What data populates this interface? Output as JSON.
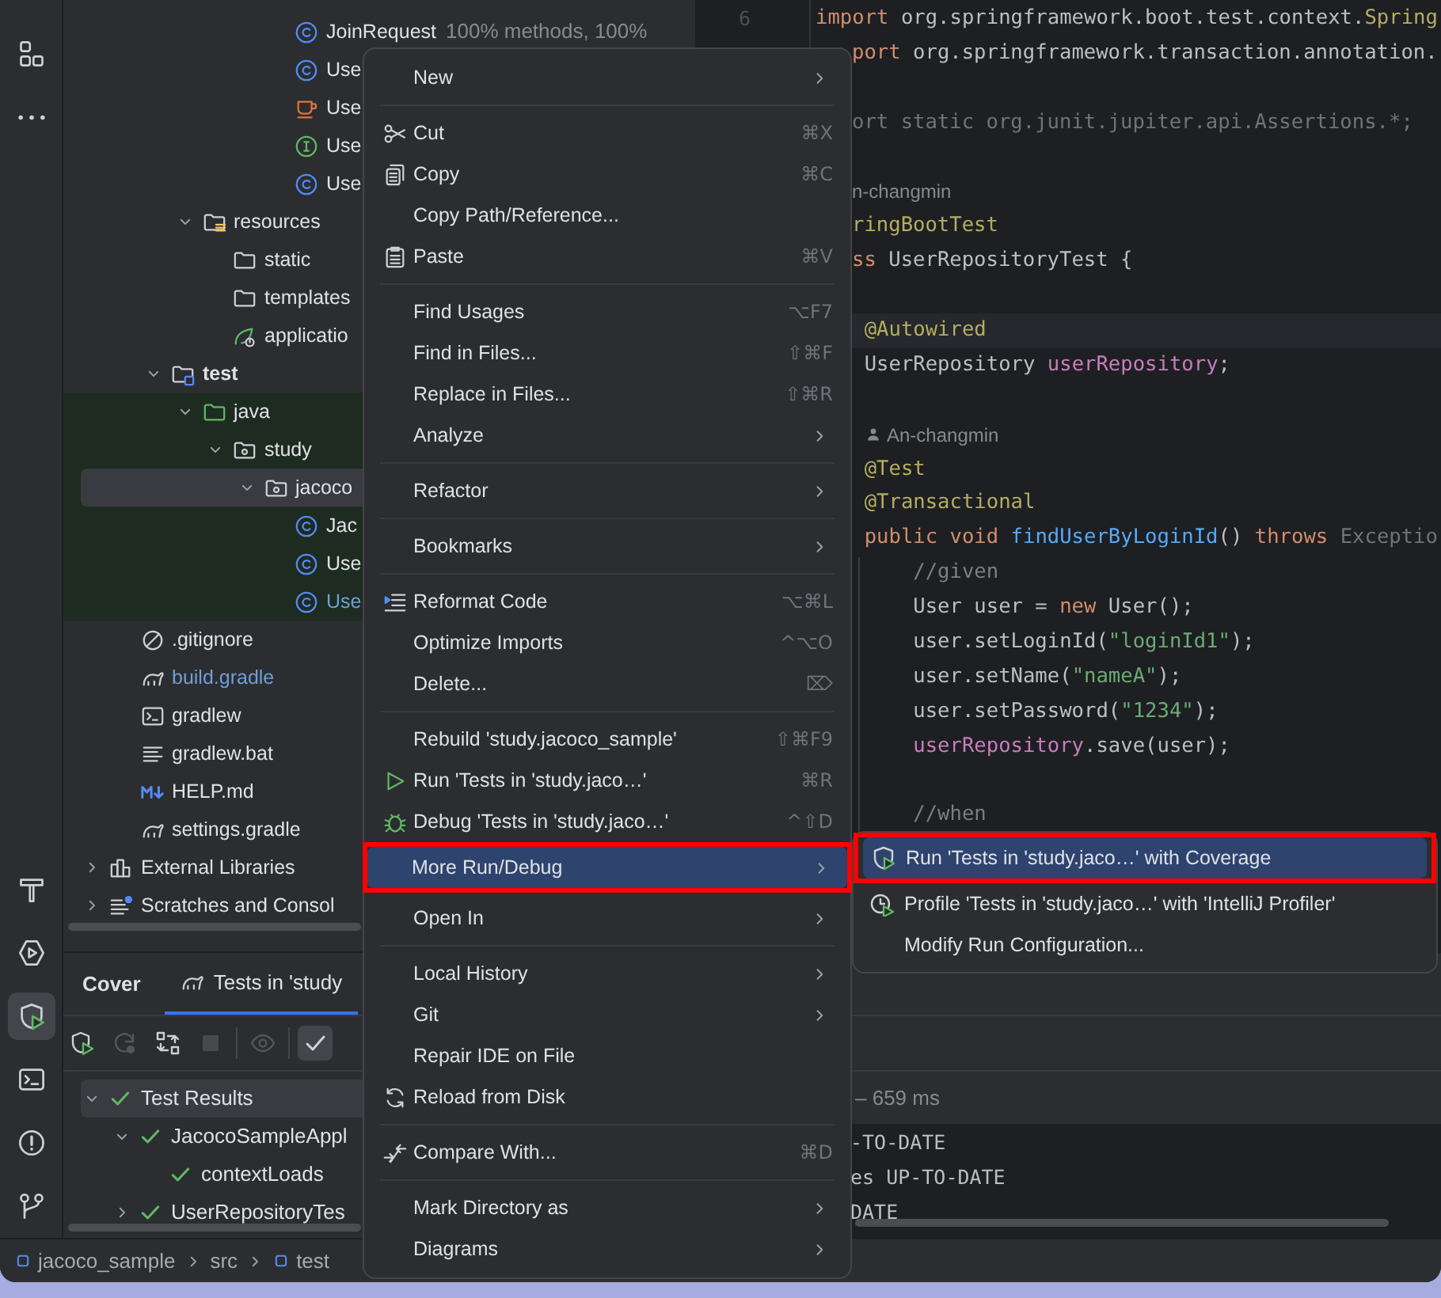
{
  "activity_bar": {
    "top": [
      {
        "kind": "structure",
        "selected": false
      },
      {
        "kind": "more",
        "selected": false
      }
    ],
    "bottom": [
      {
        "kind": "build",
        "selected": false
      },
      {
        "kind": "services",
        "selected": false
      },
      {
        "kind": "coverage",
        "selected": true
      },
      {
        "kind": "terminal",
        "selected": false
      },
      {
        "kind": "problems",
        "selected": false
      },
      {
        "kind": "git",
        "selected": false
      }
    ]
  },
  "project_tree": {
    "items": [
      {
        "children": [
          {
            "children": [
              {
                "children": [
                  {
                    "children": [
                      {
                        "children": [
                          {
                            "children": [
                              {
                                "label": "JoinRequest",
                                "kind": "class",
                                "hint": "100% methods, 100%",
                                "selected": false,
                                "modified": false
                              },
                              {
                                "label": "Use",
                                "kind": "class",
                                "selected": false,
                                "modified": false
                              },
                              {
                                "label": "Use",
                                "kind": "cup",
                                "selected": false,
                                "modified": false
                              },
                              {
                                "label": "Use",
                                "kind": "interface",
                                "selected": false,
                                "modified": false
                              },
                              {
                                "label": "Use",
                                "kind": "class",
                                "selected": false,
                                "modified": false
                              }
                            ]
                          }
                        ]
                      }
                    ]
                  },
                  {
                    "label": "resources",
                    "kind": "resources-folder",
                    "expanded": true,
                    "selected": false,
                    "modified": false,
                    "children": [
                      {
                        "label": "static",
                        "kind": "folder",
                        "selected": false,
                        "modified": false
                      },
                      {
                        "label": "templates",
                        "kind": "folder",
                        "selected": false,
                        "modified": false
                      },
                      {
                        "label": "applicatio",
                        "kind": "spring-config",
                        "selected": false,
                        "modified": false
                      }
                    ]
                  }
                ]
              },
              {
                "label": "test",
                "kind": "test-folder",
                "expanded": true,
                "bold": true,
                "selected": false,
                "modified": false,
                "children": [
                  {
                    "label": "java",
                    "kind": "source-folder",
                    "expanded": true,
                    "test_root": true,
                    "selected": false,
                    "modified": false,
                    "children": [
                      {
                        "label": "study",
                        "kind": "package",
                        "expanded": true,
                        "selected": false,
                        "modified": false,
                        "children": [
                          {
                            "label": "jacoco",
                            "kind": "package",
                            "expanded": true,
                            "selected": true,
                            "modified": false,
                            "children": [
                              {
                                "label": "Jac",
                                "kind": "class",
                                "selected": false,
                                "modified": false
                              },
                              {
                                "label": "Use",
                                "kind": "class",
                                "selected": false,
                                "modified": false
                              },
                              {
                                "label": "Use",
                                "kind": "class",
                                "selected": false,
                                "modified": true
                              }
                            ]
                          }
                        ]
                      }
                    ]
                  }
                ]
              }
            ]
          },
          {
            "label": ".gitignore",
            "kind": "ignore",
            "selected": false,
            "modified": false
          },
          {
            "label": "build.gradle",
            "kind": "gradle",
            "selected": false,
            "modified": true
          },
          {
            "label": "gradlew",
            "kind": "shell",
            "selected": false,
            "modified": false
          },
          {
            "label": "gradlew.bat",
            "kind": "text",
            "selected": false,
            "modified": false
          },
          {
            "label": "HELP.md",
            "kind": "markdown",
            "selected": false,
            "modified": false
          },
          {
            "label": "settings.gradle",
            "kind": "gradle",
            "selected": false,
            "modified": false
          }
        ]
      },
      {
        "label": "External Libraries",
        "kind": "libraries",
        "expanded": false,
        "selected": false,
        "modified": false
      },
      {
        "label": "Scratches and Consol",
        "kind": "scratches",
        "expanded": false,
        "selected": false,
        "modified": false
      }
    ]
  },
  "editor": {
    "line_number": "6",
    "lines": [
      {
        "kind": "code",
        "current": false,
        "segments": [
          {
            "text": "import ",
            "kind": "kw"
          },
          {
            "text": "org.springframework.boot.test.context.",
            "kind": "plain"
          },
          {
            "text": "Spring",
            "kind": "ann"
          }
        ]
      },
      {
        "kind": "code",
        "cut": true,
        "current": false,
        "segments": [
          {
            "text": "port ",
            "kind": "kw"
          },
          {
            "text": "org.springframework.transaction.annotation.",
            "kind": "plain"
          }
        ]
      },
      {
        "kind": "blank"
      },
      {
        "kind": "code",
        "cut": true,
        "current": false,
        "segments": [
          {
            "text": "ort static org.junit.jupiter.api.Assertions.*;",
            "kind": "muted"
          }
        ]
      },
      {
        "kind": "blank"
      },
      {
        "kind": "author",
        "cut": true,
        "member": false,
        "text": "n-changmin"
      },
      {
        "kind": "code",
        "cut": true,
        "current": false,
        "segments": [
          {
            "text": "ringBootTest",
            "kind": "ann"
          }
        ]
      },
      {
        "kind": "code",
        "cut": true,
        "current": false,
        "segments": [
          {
            "text": "ss ",
            "kind": "kw"
          },
          {
            "text": "UserRepositoryTest {",
            "kind": "plain"
          }
        ]
      },
      {
        "kind": "blank"
      },
      {
        "kind": "code",
        "current": true,
        "segments": [
          {
            "text": "    @Autowired",
            "kind": "ann"
          }
        ]
      },
      {
        "kind": "code",
        "current": false,
        "segments": [
          {
            "text": "    UserRepository ",
            "kind": "plain"
          },
          {
            "text": "userRepository",
            "kind": "field"
          },
          {
            "text": ";",
            "kind": "plain"
          }
        ]
      },
      {
        "kind": "blank"
      },
      {
        "kind": "author",
        "member": true,
        "text": "An-changmin"
      },
      {
        "kind": "code",
        "current": false,
        "segments": [
          {
            "text": "    @Test",
            "kind": "ann"
          }
        ]
      },
      {
        "kind": "code",
        "current": false,
        "segments": [
          {
            "text": "    @Transactional",
            "kind": "ann"
          }
        ]
      },
      {
        "kind": "code",
        "current": false,
        "segments": [
          {
            "text": "    public void ",
            "kind": "kw"
          },
          {
            "text": "findUserByLoginId",
            "kind": "method"
          },
          {
            "text": "() ",
            "kind": "plain"
          },
          {
            "text": "throws ",
            "kind": "kw"
          },
          {
            "text": "Exceptio",
            "kind": "muted"
          }
        ]
      },
      {
        "kind": "code",
        "current": false,
        "segments": [
          {
            "text": "        //given",
            "kind": "comment"
          }
        ]
      },
      {
        "kind": "code",
        "current": false,
        "segments": [
          {
            "text": "        User user = ",
            "kind": "plain"
          },
          {
            "text": "new ",
            "kind": "kw"
          },
          {
            "text": "User();",
            "kind": "plain"
          }
        ]
      },
      {
        "kind": "code",
        "current": false,
        "segments": [
          {
            "text": "        user.setLoginId(",
            "kind": "plain"
          },
          {
            "text": "\"loginId1\"",
            "kind": "str"
          },
          {
            "text": ");",
            "kind": "plain"
          }
        ]
      },
      {
        "kind": "code",
        "current": false,
        "segments": [
          {
            "text": "        user.setName(",
            "kind": "plain"
          },
          {
            "text": "\"nameA\"",
            "kind": "str"
          },
          {
            "text": ");",
            "kind": "plain"
          }
        ]
      },
      {
        "kind": "code",
        "current": false,
        "segments": [
          {
            "text": "        user.setPassword(",
            "kind": "plain"
          },
          {
            "text": "\"1234\"",
            "kind": "str"
          },
          {
            "text": ");",
            "kind": "plain"
          }
        ]
      },
      {
        "kind": "code",
        "current": false,
        "segments": [
          {
            "text": "        userRepository",
            "kind": "field"
          },
          {
            "text": ".save(user);",
            "kind": "plain"
          }
        ]
      },
      {
        "kind": "blank"
      },
      {
        "kind": "code",
        "current": false,
        "segments": [
          {
            "text": "        //when",
            "kind": "comment"
          }
        ]
      }
    ]
  },
  "tool_window": {
    "title": "Cover",
    "tabs": [
      {
        "label": "Tests in 'study",
        "selected": true
      }
    ],
    "toolbar": [
      {
        "kind": "coverage-run",
        "disabled": false,
        "on": false
      },
      {
        "kind": "rerun",
        "disabled": true,
        "on": false
      },
      {
        "kind": "sync",
        "disabled": false,
        "on": false
      },
      {
        "kind": "stop",
        "disabled": true,
        "on": false
      },
      {
        "kind": "separator"
      },
      {
        "kind": "eye",
        "disabled": true,
        "on": false
      },
      {
        "kind": "separator"
      },
      {
        "kind": "check",
        "disabled": false,
        "on": true
      }
    ],
    "tests": [
      {
        "label": "Test Results",
        "expanded": true,
        "selected": true,
        "passed": true,
        "children": [
          {
            "label": "JacocoSampleAppl",
            "expanded": true,
            "selected": false,
            "passed": true,
            "children": [
              {
                "label": "contextLoads",
                "selected": false,
                "passed": true
              }
            ]
          },
          {
            "label": "UserRepositoryTes",
            "expanded": false,
            "selected": false,
            "passed": true
          }
        ]
      }
    ],
    "status": "– 659 ms",
    "console": [
      "-TO-DATE",
      "es UP-TO-DATE",
      "DATE"
    ]
  },
  "breadcrumbs": [
    {
      "label": "jacoco_sample",
      "kind": "module"
    },
    {
      "label": "src",
      "kind": "plain"
    },
    {
      "label": "test",
      "kind": "module"
    }
  ],
  "context_menu": {
    "items": [
      {
        "kind": "plain",
        "label": "New",
        "submenu": true,
        "selected": false,
        "outlined": false
      },
      {
        "kind": "separator"
      },
      {
        "kind": "scissors",
        "label": "Cut",
        "shortcut": "⌘X",
        "submenu": false,
        "selected": false,
        "outlined": false
      },
      {
        "kind": "copy",
        "label": "Copy",
        "shortcut": "⌘C",
        "submenu": false,
        "selected": false,
        "outlined": false
      },
      {
        "kind": "plain",
        "label": "Copy Path/Reference...",
        "submenu": false,
        "selected": false,
        "outlined": false
      },
      {
        "kind": "clipboard",
        "label": "Paste",
        "shortcut": "⌘V",
        "submenu": false,
        "selected": false,
        "outlined": false
      },
      {
        "kind": "separator"
      },
      {
        "kind": "plain",
        "label": "Find Usages",
        "shortcut": "⌥F7",
        "submenu": false,
        "selected": false,
        "outlined": false
      },
      {
        "kind": "plain",
        "label": "Find in Files...",
        "shortcut": "⇧⌘F",
        "submenu": false,
        "selected": false,
        "outlined": false
      },
      {
        "kind": "plain",
        "label": "Replace in Files...",
        "shortcut": "⇧⌘R",
        "submenu": false,
        "selected": false,
        "outlined": false
      },
      {
        "kind": "plain",
        "label": "Analyze",
        "submenu": true,
        "selected": false,
        "outlined": false
      },
      {
        "kind": "separator"
      },
      {
        "kind": "plain",
        "label": "Refactor",
        "submenu": true,
        "selected": false,
        "outlined": false
      },
      {
        "kind": "separator"
      },
      {
        "kind": "plain",
        "label": "Bookmarks",
        "submenu": true,
        "selected": false,
        "outlined": false
      },
      {
        "kind": "separator"
      },
      {
        "kind": "reformat",
        "label": "Reformat Code",
        "shortcut": "⌥⌘L",
        "submenu": false,
        "selected": false,
        "outlined": false
      },
      {
        "kind": "plain",
        "label": "Optimize Imports",
        "shortcut": "^⌥O",
        "submenu": false,
        "selected": false,
        "outlined": false
      },
      {
        "kind": "plain",
        "label": "Delete...",
        "shortcut": "⌦",
        "submenu": false,
        "selected": false,
        "outlined": false
      },
      {
        "kind": "separator"
      },
      {
        "kind": "plain",
        "label": "Rebuild 'study.jacoco_sample'",
        "shortcut": "⇧⌘F9",
        "submenu": false,
        "selected": false,
        "outlined": false
      },
      {
        "kind": "run",
        "label": "Run 'Tests in 'study.jaco…'",
        "shortcut": "⌘R",
        "submenu": false,
        "selected": false,
        "outlined": false
      },
      {
        "kind": "debug",
        "label": "Debug 'Tests in 'study.jaco…'",
        "shortcut": "^⇧D",
        "submenu": false,
        "selected": false,
        "outlined": false
      },
      {
        "kind": "plain",
        "label": "More Run/Debug",
        "submenu": true,
        "selected": true,
        "outlined": true
      },
      {
        "kind": "separator"
      },
      {
        "kind": "plain",
        "label": "Open In",
        "submenu": true,
        "selected": false,
        "outlined": false
      },
      {
        "kind": "separator"
      },
      {
        "kind": "plain",
        "label": "Local History",
        "submenu": true,
        "selected": false,
        "outlined": false
      },
      {
        "kind": "plain",
        "label": "Git",
        "submenu": true,
        "selected": false,
        "outlined": false
      },
      {
        "kind": "plain",
        "label": "Repair IDE on File",
        "submenu": false,
        "selected": false,
        "outlined": false
      },
      {
        "kind": "reload",
        "label": "Reload from Disk",
        "submenu": false,
        "selected": false,
        "outlined": false
      },
      {
        "kind": "separator"
      },
      {
        "kind": "compare",
        "label": "Compare With...",
        "shortcut": "⌘D",
        "submenu": false,
        "selected": false,
        "outlined": false
      },
      {
        "kind": "separator"
      },
      {
        "kind": "plain",
        "label": "Mark Directory as",
        "submenu": true,
        "selected": false,
        "outlined": false
      },
      {
        "kind": "plain",
        "label": "Diagrams",
        "submenu": true,
        "selected": false,
        "outlined": false
      }
    ]
  },
  "submenu": {
    "items": [
      {
        "kind": "coverage",
        "label": "Run 'Tests in 'study.jaco…' with Coverage",
        "selected": true,
        "outlined": true
      },
      {
        "kind": "profiler",
        "label": "Profile 'Tests in 'study.jaco…' with 'IntelliJ Profiler'",
        "selected": false,
        "outlined": false
      },
      {
        "kind": "plain",
        "label": "Modify Run Configuration...",
        "selected": false,
        "outlined": false
      }
    ]
  }
}
